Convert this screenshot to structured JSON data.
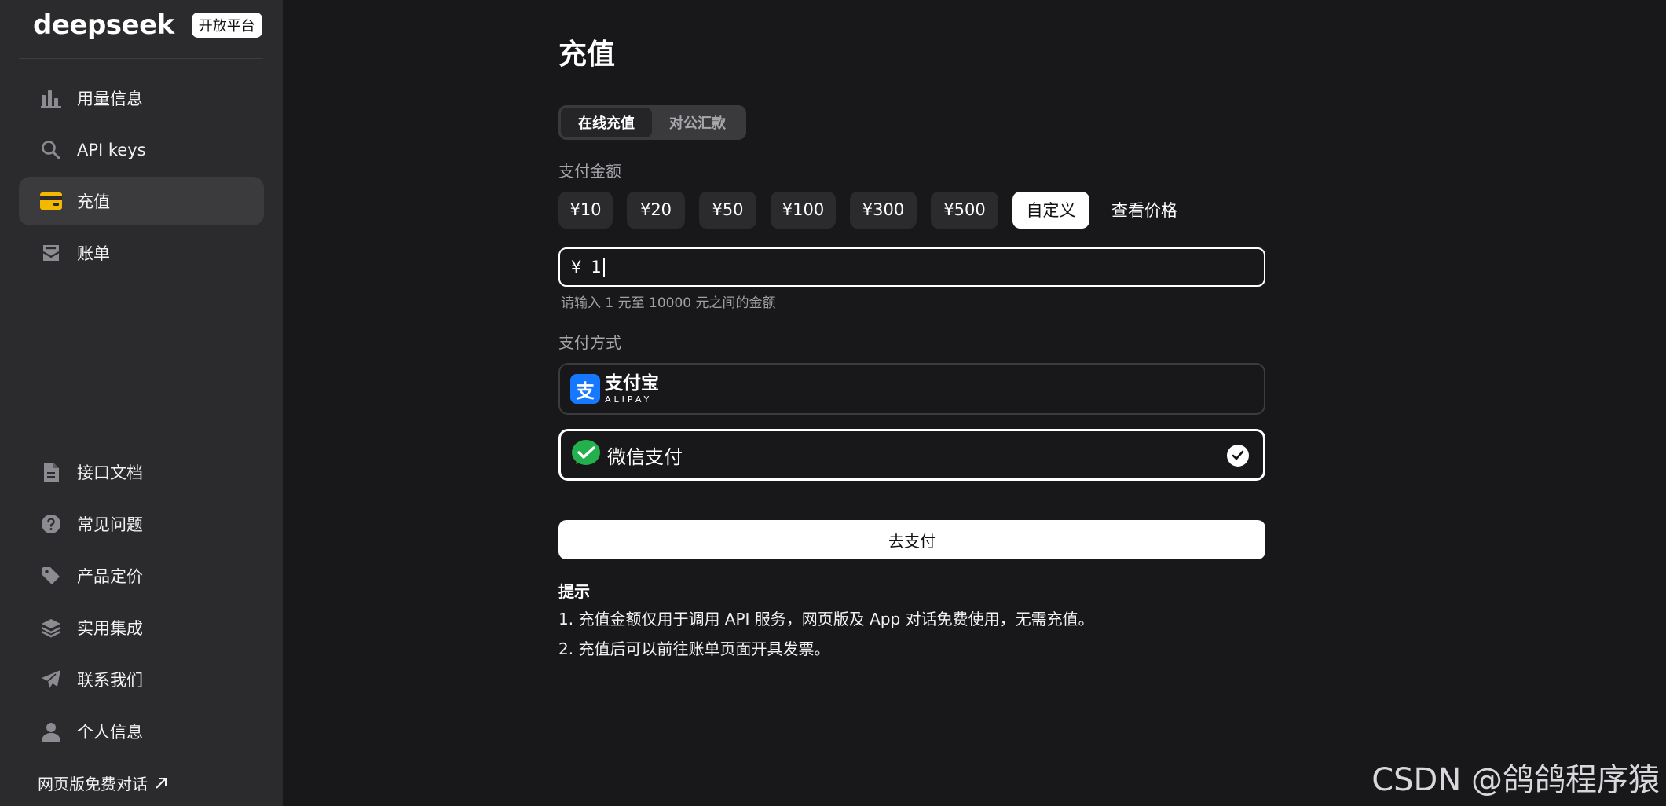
{
  "sidebar": {
    "brand": "deepseek",
    "badge": "开放平台",
    "top_items": [
      {
        "label": "用量信息",
        "icon": "bar-chart-icon"
      },
      {
        "label": "API keys",
        "icon": "search-key-icon"
      },
      {
        "label": "充值",
        "icon": "wallet-icon",
        "active": true
      },
      {
        "label": "账单",
        "icon": "bill-icon"
      }
    ],
    "bottom_items": [
      {
        "label": "接口文档",
        "icon": "document-icon"
      },
      {
        "label": "常见问题",
        "icon": "question-icon"
      },
      {
        "label": "产品定价",
        "icon": "tag-icon"
      },
      {
        "label": "实用集成",
        "icon": "layers-icon"
      },
      {
        "label": "联系我们",
        "icon": "send-icon"
      },
      {
        "label": "个人信息",
        "icon": "user-icon"
      }
    ],
    "footer_link": "网页版免费对话"
  },
  "main": {
    "title": "充值",
    "tabs": [
      {
        "label": "在线充值",
        "active": true
      },
      {
        "label": "对公汇款",
        "active": false
      }
    ],
    "amount_label": "支付金额",
    "amounts": [
      "¥10",
      "¥20",
      "¥50",
      "¥100",
      "¥300",
      "¥500"
    ],
    "custom_label": "自定义",
    "price_link": "查看价格",
    "input": {
      "currency": "¥",
      "value": "1"
    },
    "hint": "请输入 1 元至 10000 元之间的金额",
    "method_label": "支付方式",
    "alipay": {
      "cn": "支付宝",
      "en": "ALIPAY",
      "glyph": "支"
    },
    "wechat": {
      "label": "微信支付",
      "selected": true
    },
    "pay_button": "去支付",
    "tips_title": "提示",
    "tips": [
      "1. 充值金额仅用于调用 API 服务，网页版及 App 对话免费使用，无需充值。",
      "2. 充值后可以前往账单页面开具发票。"
    ]
  },
  "watermark": "CSDN @鸽鸽程序猿",
  "colors": {
    "sidebar_bg": "#2b2b2d",
    "page_bg": "#18181a",
    "accent_yellow": "#f5b800",
    "alipay_blue": "#1677ff",
    "wechat_green": "#22b14c"
  }
}
